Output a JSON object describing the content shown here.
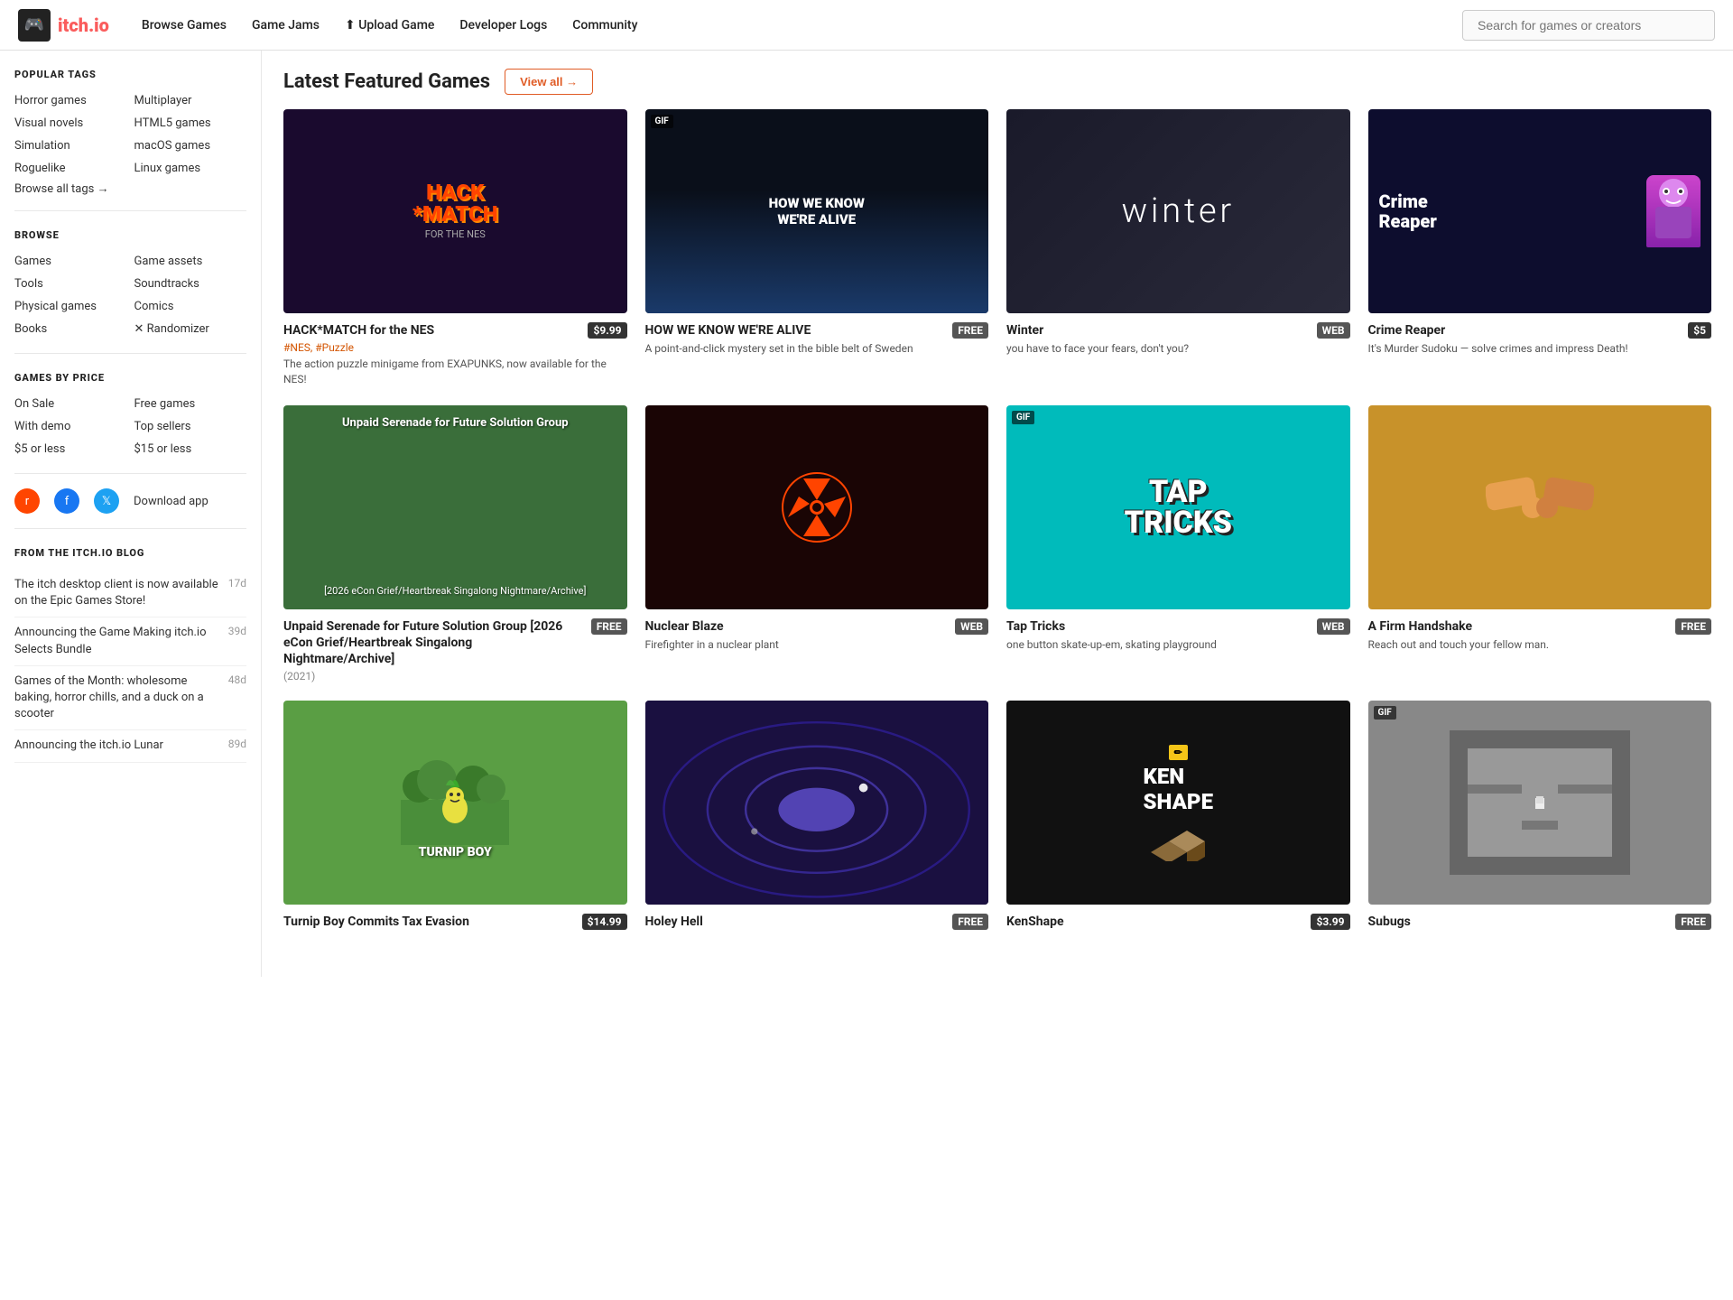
{
  "header": {
    "logo_text": "itch.io",
    "nav": [
      {
        "label": "Browse Games",
        "id": "browse-games"
      },
      {
        "label": "Game Jams",
        "id": "game-jams"
      },
      {
        "label": "Upload Game",
        "id": "upload-game"
      },
      {
        "label": "Developer Logs",
        "id": "developer-logs"
      },
      {
        "label": "Community",
        "id": "community"
      }
    ],
    "search_placeholder": "Search for games or creators"
  },
  "sidebar": {
    "popular_tags_title": "POPULAR TAGS",
    "popular_tags": [
      {
        "label": "Horror games",
        "col": 0
      },
      {
        "label": "Multiplayer",
        "col": 1
      },
      {
        "label": "Visual novels",
        "col": 0
      },
      {
        "label": "HTML5 games",
        "col": 1
      },
      {
        "label": "Simulation",
        "col": 0
      },
      {
        "label": "macOS games",
        "col": 1
      },
      {
        "label": "Roguelike",
        "col": 0
      },
      {
        "label": "Linux games",
        "col": 1
      }
    ],
    "browse_all_tags": "Browse all tags →",
    "browse_title": "BROWSE",
    "browse_links": [
      {
        "label": "Games",
        "col": 0
      },
      {
        "label": "Game assets",
        "col": 1
      },
      {
        "label": "Tools",
        "col": 0
      },
      {
        "label": "Soundtracks",
        "col": 1
      },
      {
        "label": "Physical games",
        "col": 0
      },
      {
        "label": "Comics",
        "col": 1
      },
      {
        "label": "Books",
        "col": 0
      },
      {
        "label": "✕ Randomizer",
        "col": 1
      }
    ],
    "price_title": "GAMES BY PRICE",
    "price_links": [
      {
        "label": "On Sale",
        "col": 0
      },
      {
        "label": "Free games",
        "col": 1
      },
      {
        "label": "With demo",
        "col": 0
      },
      {
        "label": "Top sellers",
        "col": 1
      },
      {
        "label": "$5 or less",
        "col": 0
      },
      {
        "label": "$15 or less",
        "col": 1
      }
    ],
    "social_download": "Download app",
    "blog_title": "FROM THE ITCH.IO BLOG",
    "blog_items": [
      {
        "text": "The itch desktop client is now available on the Epic Games Store!",
        "days": "17d"
      },
      {
        "text": "Announcing the Game Making itch.io Selects Bundle",
        "days": "39d"
      },
      {
        "text": "Games of the Month: wholesome baking, horror chills, and a duck on a scooter",
        "days": "48d"
      },
      {
        "text": "Announcing the itch.io Lunar",
        "days": "89d"
      }
    ]
  },
  "main": {
    "section_title": "Latest Featured Games",
    "view_all_label": "View all →",
    "games": [
      {
        "id": "hack-match",
        "title": "HACK*MATCH for the NES",
        "price": "$9.99",
        "price_type": "paid",
        "tags": "#NES, #Puzzle",
        "desc": "The action puzzle minigame from EXAPUNKS, now available for the NES!",
        "thumb_type": "hack",
        "gif": false
      },
      {
        "id": "how-we-know",
        "title": "HOW WE KNOW WE'RE ALIVE",
        "price": "FREE",
        "price_type": "free",
        "desc": "A point-and-click mystery set in the bible belt of Sweden",
        "thumb_type": "how",
        "gif": true
      },
      {
        "id": "winter",
        "title": "Winter",
        "price": "WEB",
        "price_type": "web",
        "desc": "you have to face your fears, don't you?",
        "thumb_type": "winter",
        "gif": false
      },
      {
        "id": "crime-reaper",
        "title": "Crime Reaper",
        "price": "$5",
        "price_type": "paid",
        "desc": "It's Murder Sudoku — solve crimes and impress Death!",
        "thumb_type": "crime",
        "gif": false
      },
      {
        "id": "unpaid-serenade",
        "title": "Unpaid Serenade for Future Solution Group [2026 eCon Grief/Heartbreak Singalong Nightmare/Archive]",
        "price": "FREE",
        "price_type": "free",
        "year": "(2021)",
        "thumb_type": "unpaid",
        "gif": false
      },
      {
        "id": "nuclear-blaze",
        "title": "Nuclear Blaze",
        "price": "WEB",
        "price_type": "web",
        "desc": "Firefighter in a nuclear plant",
        "thumb_type": "nuclear",
        "gif": false
      },
      {
        "id": "tap-tricks",
        "title": "Tap Tricks",
        "price": "WEB",
        "price_type": "web",
        "desc": "one button skate-up-em, skating playground",
        "thumb_type": "tap",
        "gif": true
      },
      {
        "id": "firm-handshake",
        "title": "A Firm Handshake",
        "price": "FREE",
        "price_type": "free",
        "desc": "Reach out and touch your fellow man.",
        "thumb_type": "firm",
        "gif": false
      },
      {
        "id": "turnip-boy",
        "title": "Turnip Boy Commits Tax Evasion",
        "price": "$14.99",
        "price_type": "paid",
        "thumb_type": "turnip",
        "gif": false
      },
      {
        "id": "holey-hell",
        "title": "Holey Hell",
        "price": "FREE",
        "price_type": "free",
        "thumb_type": "holey",
        "gif": true
      },
      {
        "id": "kenshape",
        "title": "KenShape",
        "price": "$3.99",
        "price_type": "paid",
        "thumb_type": "ken",
        "gif": false
      },
      {
        "id": "subugs",
        "title": "Subugs",
        "price": "FREE",
        "price_type": "free",
        "thumb_type": "subugs",
        "gif": true
      }
    ]
  }
}
